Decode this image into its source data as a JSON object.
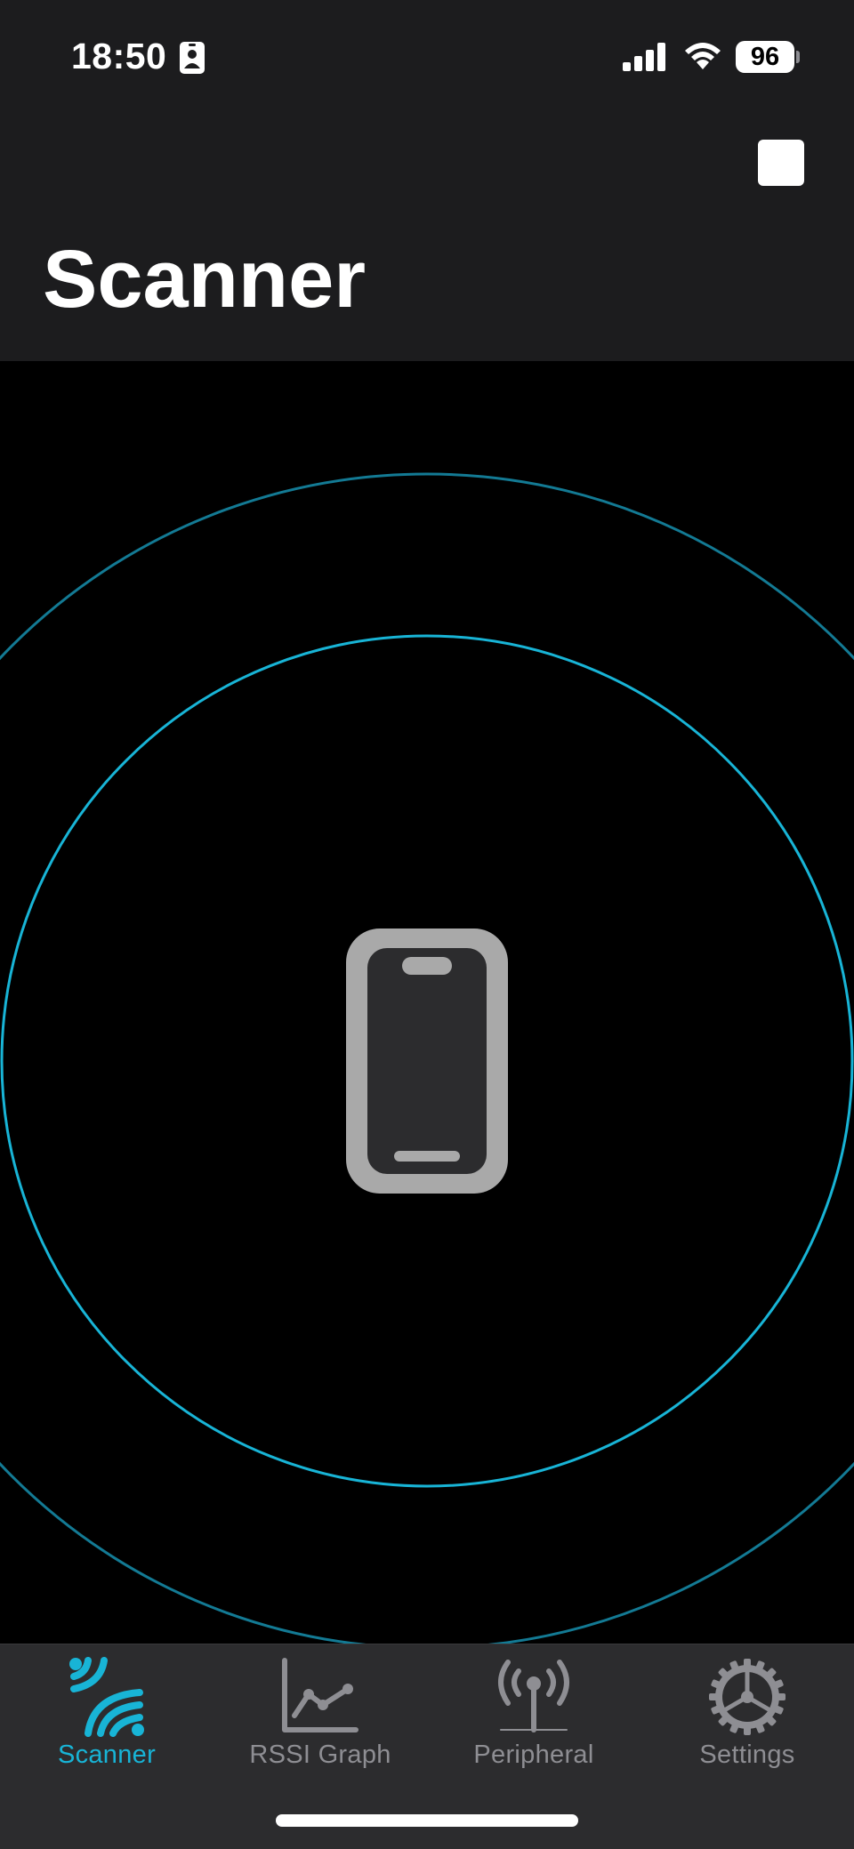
{
  "status_bar": {
    "time": "18:50",
    "battery": "96"
  },
  "nav": {
    "title": "Scanner",
    "stop_icon": "stop-square-icon"
  },
  "radar": {
    "center_icon": "iphone-icon",
    "ring_color": "#18b4d6",
    "outer_ring_color": "#137a94"
  },
  "tabs": [
    {
      "label": "Scanner",
      "icon": "scanner-waves-icon",
      "active": true
    },
    {
      "label": "RSSI Graph",
      "icon": "line-graph-icon",
      "active": false
    },
    {
      "label": "Peripheral",
      "icon": "antenna-broadcast-icon",
      "active": false
    },
    {
      "label": "Settings",
      "icon": "gear-icon",
      "active": false
    }
  ],
  "colors": {
    "accent": "#18b4d6",
    "header_bg": "#1c1c1e",
    "tabbar_bg": "#2c2c2e",
    "inactive": "#8e8e93"
  }
}
